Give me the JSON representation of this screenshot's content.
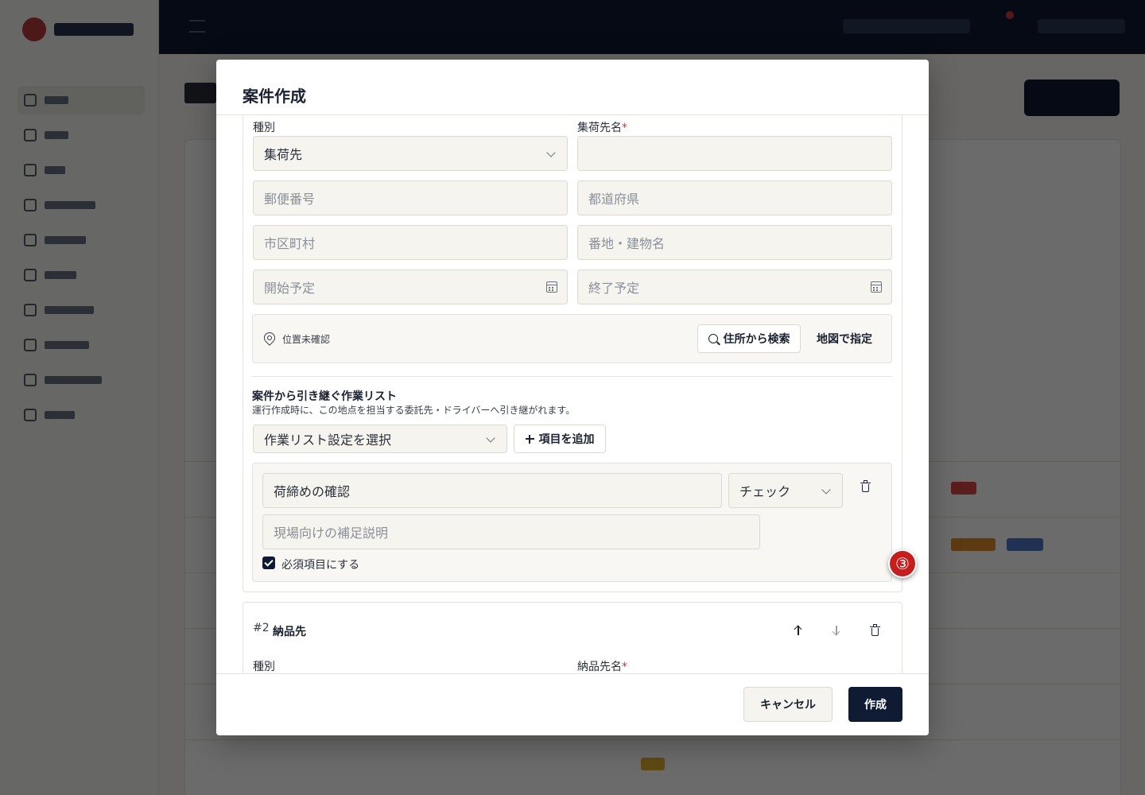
{
  "modal": {
    "title": "案件作成"
  },
  "pickup": {
    "type_label": "種別",
    "type_value": "集荷先",
    "name_label": "集荷先名",
    "required_mark": "*",
    "name_value": "",
    "postal_placeholder": "郵便番号",
    "prefecture_placeholder": "都道府県",
    "city_placeholder": "市区町村",
    "address_placeholder": "番地・建物名",
    "start_placeholder": "開始予定",
    "end_placeholder": "終了予定",
    "location_status": "位置未確認",
    "search_address_label": "住所から検索",
    "map_pick_label": "地図で指定"
  },
  "worklist": {
    "title": "案件から引き継ぐ作業リスト",
    "description": "運行作成時に、この地点を担当する委託先・ドライバーへ引き継がれます。",
    "preset_select": "作業リスト設定を選択",
    "add_item_label": "項目を追加",
    "item": {
      "name_value": "荷締めの確認",
      "type_value": "チェック",
      "note_placeholder": "現場向けの補足説明",
      "required_label": "必須項目にする",
      "required_checked": true
    }
  },
  "delivery": {
    "number": "#2",
    "title": "納品先",
    "type_label": "種別",
    "name_label": "納品先名",
    "required_mark": "*"
  },
  "footer": {
    "cancel_label": "キャンセル",
    "create_label": "作成"
  },
  "step_badge": "③",
  "colors": {
    "primary": "#0f1a33",
    "required": "#c23a3a",
    "badge": "#c41e1e"
  }
}
